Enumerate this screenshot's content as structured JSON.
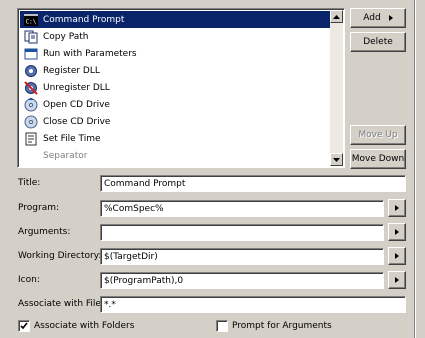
{
  "tools_list": {
    "items": [
      {
        "label": "Command Prompt",
        "icon": "command-prompt-icon",
        "selected": true
      },
      {
        "label": "Copy Path",
        "icon": "copy-path-icon"
      },
      {
        "label": "Run with Parameters",
        "icon": "run-window-icon"
      },
      {
        "label": "Register DLL",
        "icon": "gear-icon"
      },
      {
        "label": "Unregister DLL",
        "icon": "gear-remove-icon"
      },
      {
        "label": "Open CD Drive",
        "icon": "cd-open-icon"
      },
      {
        "label": "Close CD Drive",
        "icon": "cd-close-icon"
      },
      {
        "label": "Set File Time",
        "icon": "document-icon"
      },
      {
        "label": "Separator",
        "icon": "",
        "disabled": true
      }
    ]
  },
  "buttons": {
    "add": "Add",
    "delete": "Delete",
    "move_up": "Move Up",
    "move_down": "Move Down"
  },
  "form": {
    "title_label": "Title:",
    "title_value": "Command Prompt",
    "program_label": "Program:",
    "program_value": "%ComSpec%",
    "arguments_label": "Arguments:",
    "arguments_value": "",
    "working_dir_label": "Working Directory:",
    "working_dir_value": "$(TargetDir)",
    "icon_label": "Icon:",
    "icon_value": "$(ProgramPath),0",
    "associate_files_label": "Associate with Files:",
    "associate_files_value": "*.*",
    "associate_folders_label": "Associate with Folders",
    "associate_folders_checked": true,
    "prompt_args_label": "Prompt for Arguments",
    "prompt_args_checked": false
  },
  "colors": {
    "face": "#d4d0c8",
    "selection": "#0a246a"
  }
}
